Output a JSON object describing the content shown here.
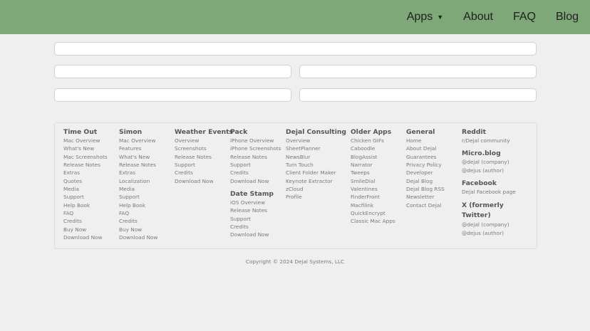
{
  "nav": {
    "apps": "Apps",
    "apps_caret": "▼",
    "about": "About",
    "faq": "FAQ",
    "blog": "Blog"
  },
  "columns": [
    {
      "id": "time-out",
      "heading": "Time Out",
      "links": [
        "Mac Overview",
        "What's New",
        "Mac Screenshots",
        "Release Notes",
        "Extras",
        "Quotes",
        "Media",
        "Support",
        "Help Book",
        "FAQ",
        "Credits",
        "Buy Now",
        "Download Now"
      ]
    },
    {
      "id": "simon",
      "heading": "Simon",
      "links": [
        "Mac Overview",
        "Features",
        "What's New",
        "Release Notes",
        "Extras",
        "Localization",
        "Media",
        "Support",
        "Help Book",
        "FAQ",
        "Credits",
        "Buy Now",
        "Download Now"
      ]
    },
    {
      "id": "weather-events",
      "heading": "Weather Events",
      "links": [
        "Overview",
        "Screenshots",
        "Release Notes",
        "Support",
        "Credits",
        "Download Now"
      ]
    },
    {
      "id": "pack",
      "heading": "Pack",
      "links": [
        "iPhone Overview",
        "iPhone Screenshots",
        "Release Notes",
        "Support",
        "Credits",
        "Download Now"
      ],
      "heading2": "Date Stamp",
      "links2": [
        "iOS Overview",
        "Release Notes",
        "Support",
        "Credits",
        "Download Now"
      ]
    },
    {
      "id": "dejal-consulting",
      "heading": "Dejal Consulting",
      "links": [
        "Overview",
        "SheetPlanner",
        "NewsBlur",
        "Turn Touch",
        "Client Folder Maker",
        "Keynote Extractor",
        "zCloud",
        "Profile"
      ]
    },
    {
      "id": "older-apps",
      "heading": "Older Apps",
      "links": [
        "Chicken GIFs",
        "Caboodle",
        "BlogAssist",
        "Narrator",
        "Tweeps",
        "SmileDial",
        "Valentines",
        "FinderFront",
        "Macfilink",
        "QuickEncrypt",
        "Classic Mac Apps"
      ]
    },
    {
      "id": "general",
      "heading": "General",
      "links": [
        "Home",
        "About Dejal",
        "Guarantees",
        "Privacy Policy",
        "Developer",
        "Dejal Blog",
        "Dejal Blog RSS",
        "Newsletter",
        "Contact Dejal"
      ]
    },
    {
      "id": "social",
      "heading": "Reddit",
      "links": [
        "r/Dejal community"
      ],
      "heading2": "Micro.blog",
      "links2": [
        "@dejal (company)",
        "@dejus (author)"
      ],
      "heading3": "Facebook",
      "links3": [
        "Dejal Facebook page"
      ],
      "heading4": "X (formerly Twitter)",
      "links4": [
        "@dejal (company)",
        "@dejus (author)"
      ]
    }
  ],
  "copyright": "Copyright © 2024 Dejal Systems, LLC"
}
